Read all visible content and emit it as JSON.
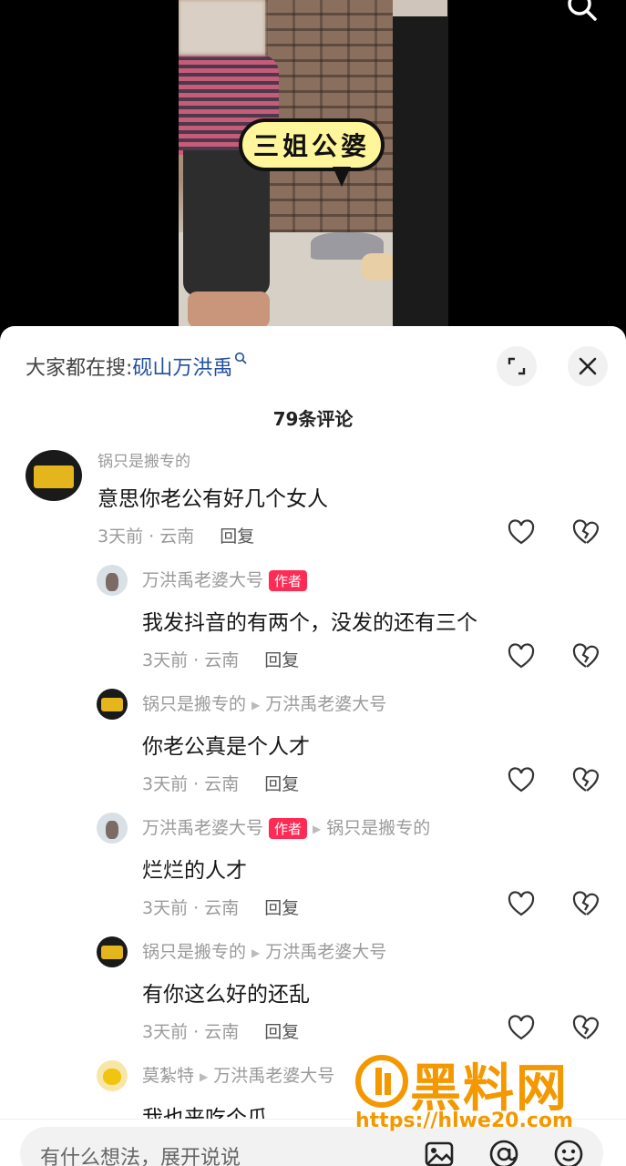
{
  "video": {
    "bubble_text": "三姐公婆"
  },
  "panel": {
    "trending_prefix": "大家都在搜:",
    "trending_keyword": "砚山万洪禹",
    "comment_count": "79条评论"
  },
  "comments": [
    {
      "author": "锅只是搬专的",
      "text": "意思你老公有好几个女人",
      "time_location": "3天前 · 云南",
      "reply_label": "回复"
    },
    {
      "author": "万洪禹老婆大号",
      "badge": "作者",
      "text": "我发抖音的有两个，没发的还有三个",
      "time_location": "3天前 · 云南",
      "reply_label": "回复"
    },
    {
      "author": "锅只是搬专的",
      "reply_to": "万洪禹老婆大号",
      "text": "你老公真是个人才",
      "time_location": "3天前 · 云南",
      "reply_label": "回复"
    },
    {
      "author": "万洪禹老婆大号",
      "badge": "作者",
      "reply_to": "锅只是搬专的",
      "text": "烂烂的人才",
      "time_location": "3天前 · 云南",
      "reply_label": "回复"
    },
    {
      "author": "锅只是搬专的",
      "reply_to": "万洪禹老婆大号",
      "text": "有你这么好的还乱",
      "time_location": "3天前 · 云南",
      "reply_label": "回复"
    },
    {
      "author": "莫紮特",
      "reply_to": "万洪禹老婆大号",
      "text": "我也来吃个瓜"
    }
  ],
  "input": {
    "placeholder": "有什么想法，展开说说"
  },
  "watermark": {
    "title": "黑料网",
    "url": "https://hlwe20.com"
  },
  "icons": {
    "search": "search-icon",
    "expand": "expand-icon",
    "close": "close-icon",
    "like": "heart-icon",
    "dislike": "broken-heart-icon",
    "image": "image-icon",
    "mention": "at-icon",
    "emoji": "emoji-icon"
  },
  "colors": {
    "keyword": "#1f4f9e",
    "author_badge": "#fe2c55",
    "watermark": "#f39800"
  }
}
